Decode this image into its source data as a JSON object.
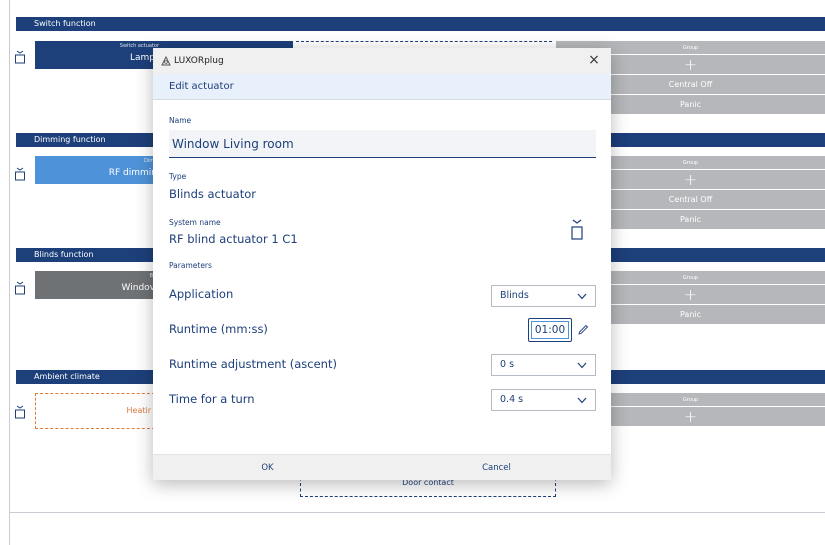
{
  "sections": {
    "switch": {
      "title": "Switch function",
      "card_caption": "Switch actuator",
      "card_label": "Lamp"
    },
    "dimming": {
      "title": "Dimming function",
      "card_caption": "Dimm",
      "card_label": "RF dimmir"
    },
    "blinds": {
      "title": "Blinds function",
      "card_caption": "Blin",
      "card_label": "Windov"
    },
    "ambient": {
      "title": "Ambient climate",
      "card_label": "Heatir"
    }
  },
  "groups": {
    "switch": {
      "header": "Group",
      "plus": "+",
      "items": [
        "Central Off",
        "Panic"
      ]
    },
    "dimming": {
      "header": "Group",
      "plus": "+",
      "items": [
        "Central Off",
        "Panic"
      ]
    },
    "blinds": {
      "header": "Group",
      "plus": "+",
      "items": [
        "Panic"
      ]
    },
    "ambient": {
      "header": "Group",
      "plus": "+"
    }
  },
  "door_contact": "Door contact",
  "dialog": {
    "app_name": "LUXORplug",
    "close_symbol": "×",
    "header": "Edit actuator",
    "name_label": "Name",
    "name_value": "Window Living room",
    "type_label": "Type",
    "type_value": "Blinds actuator",
    "system_name_label": "System name",
    "system_name_value": "RF blind actuator 1 C1",
    "parameters_label": "Parameters",
    "application_label": "Application",
    "application_value": "Blinds",
    "runtime_label": "Runtime (mm:ss)",
    "runtime_value": "01:00",
    "runtime_adj_label": "Runtime adjustment (ascent)",
    "runtime_adj_value": "0 s",
    "turn_label": "Time for a turn",
    "turn_value": "0.4 s",
    "ok_label": "OK",
    "cancel_label": "Cancel"
  },
  "colors": {
    "navy": "#1d3f7a",
    "light_blue": "#4e93d9",
    "gray": "#b5b7ba",
    "orange": "#e07a3c"
  }
}
